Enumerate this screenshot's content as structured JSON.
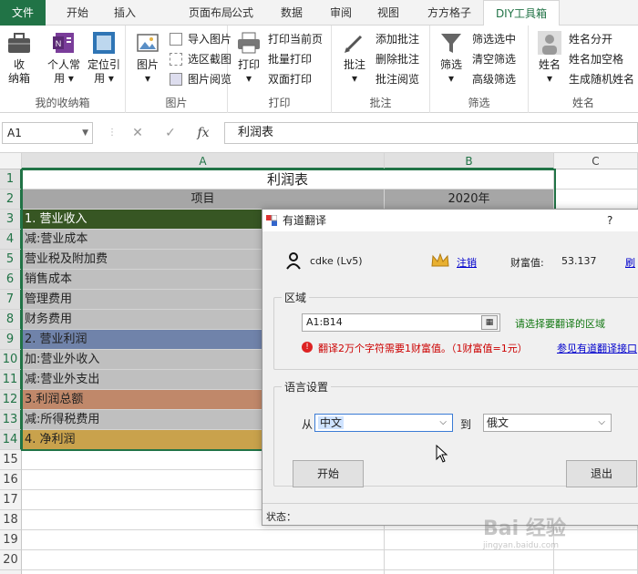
{
  "tabs": [
    "文件",
    "开始",
    "插入",
    "页面布局",
    "公式",
    "数据",
    "审阅",
    "视图",
    "方方格子",
    "DIY工具箱"
  ],
  "ribbon": {
    "groups": {
      "my_box": {
        "label": "我的收纳箱",
        "btn1": "收\n纳箱",
        "btn2": "个人常\n用 ▾",
        "btn3": "定位引\n用 ▾"
      },
      "picture": {
        "label": "图片",
        "big": "图片\n▾",
        "items": [
          "导入图片",
          "选区截图",
          "图片阅览"
        ]
      },
      "print": {
        "label": "打印",
        "big": "打印\n▾",
        "items": [
          "打印当前页",
          "批量打印",
          "双面打印"
        ]
      },
      "comment": {
        "label": "批注",
        "big": "批注\n▾",
        "items": [
          "添加批注",
          "删除批注",
          "批注阅览"
        ]
      },
      "filter": {
        "label": "筛选",
        "big": "筛选\n▾",
        "items": [
          "筛选选中",
          "清空筛选",
          "高级筛选"
        ]
      },
      "name": {
        "label": "姓名",
        "big": "姓名\n▾",
        "items": [
          "姓名分开",
          "姓名加空格",
          "生成随机姓名"
        ]
      }
    }
  },
  "formula_bar": {
    "name_box": "A1",
    "formula": "利润表"
  },
  "grid": {
    "col_headers": [
      "A",
      "B",
      "C"
    ],
    "title": "利润表",
    "header_row": {
      "a": "项目",
      "b": "2020年"
    },
    "rows": [
      {
        "n": "1"
      },
      {
        "n": "2"
      },
      {
        "n": "3",
        "a": "1. 营业收入",
        "color": "#375623",
        "fg": "#ffffff"
      },
      {
        "n": "4",
        "a": "减:营业成本",
        "color": "#bfbfbf"
      },
      {
        "n": "5",
        "a": "营业税及附加费",
        "color": "#bfbfbf"
      },
      {
        "n": "6",
        "a": "销售成本",
        "color": "#bfbfbf"
      },
      {
        "n": "7",
        "a": "管理费用",
        "color": "#bfbfbf"
      },
      {
        "n": "8",
        "a": "财务费用",
        "color": "#bfbfbf"
      },
      {
        "n": "9",
        "a": "2. 营业利润",
        "color": "#7083aa"
      },
      {
        "n": "10",
        "a": "加:营业外收入",
        "color": "#bfbfbf"
      },
      {
        "n": "11",
        "a": "减:营业外支出",
        "color": "#bfbfbf"
      },
      {
        "n": "12",
        "a": "3.利润总额",
        "color": "#c0886a"
      },
      {
        "n": "13",
        "a": "减:所得税费用",
        "color": "#bfbfbf"
      },
      {
        "n": "14",
        "a": "4. 净利润",
        "color": "#c9a24c"
      },
      {
        "n": "15"
      },
      {
        "n": "16"
      },
      {
        "n": "17"
      },
      {
        "n": "18"
      },
      {
        "n": "19"
      },
      {
        "n": "20"
      },
      {
        "n": "21"
      }
    ]
  },
  "dialog": {
    "title": "有道翻译",
    "help": "?",
    "user": "cdke (Lv5)",
    "logout": "注销",
    "wealth_label": "财富值:",
    "wealth_value": "53.137",
    "refresh": "刷",
    "region_legend": "区域",
    "range": "A1:B14",
    "range_hint": "请选择要翻译的区域",
    "cost_note": "翻译2万个字符需要1财富值。（1财富值=1元）",
    "api_link": "参见有道翻译接口",
    "lang_legend": "语言设置",
    "from_label": "从",
    "from_value": "中文",
    "to_label": "到",
    "to_value": "俄文",
    "start_btn": "开始",
    "exit_btn": "退出",
    "status_label": "状态："
  },
  "watermark": "Bai 经验",
  "watermark_sub": "jingyan.baidu.com",
  "colors": {
    "excel_green": "#217346",
    "header_gray": "#f3f3f3"
  }
}
